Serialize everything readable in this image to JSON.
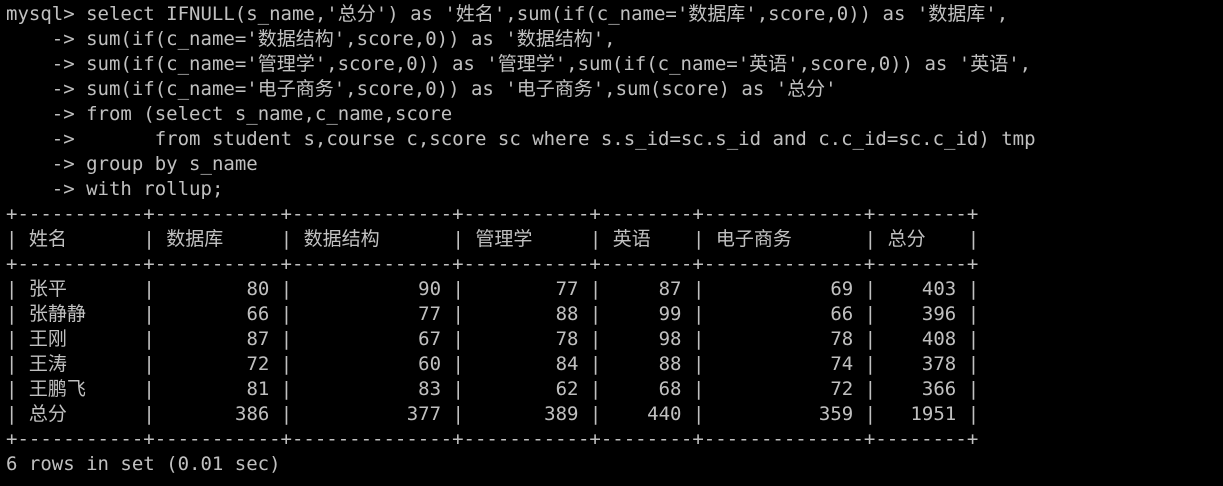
{
  "terminal": {
    "prompt": "mysql>",
    "continuation": "->",
    "query_lines": [
      "select IFNULL(s_name,'总分') as '姓名',sum(if(c_name='数据库',score,0)) as '数据库',",
      "sum(if(c_name='数据结构',score,0)) as '数据结构',",
      "sum(if(c_name='管理学',score,0)) as '管理学',sum(if(c_name='英语',score,0)) as '英语',",
      "sum(if(c_name='电子商务',score,0)) as '电子商务',sum(score) as '总分'",
      "from (select s_name,c_name,score",
      "      from student s,course c,score sc where s.s_id=sc.s_id and c.c_id=sc.c_id) tmp",
      "group by s_name",
      "with rollup;"
    ],
    "table": {
      "columns": [
        "姓名",
        "数据库",
        "数据结构",
        "管理学",
        "英语",
        "电子商务",
        "总分"
      ],
      "rows": [
        [
          "张平",
          "80",
          "90",
          "77",
          "87",
          "69",
          "403"
        ],
        [
          "张静静",
          "66",
          "77",
          "88",
          "99",
          "66",
          "396"
        ],
        [
          "王刚",
          "87",
          "67",
          "78",
          "98",
          "78",
          "408"
        ],
        [
          "王涛",
          "72",
          "60",
          "84",
          "88",
          "74",
          "378"
        ],
        [
          "王鹏飞",
          "81",
          "83",
          "62",
          "68",
          "72",
          "366"
        ],
        [
          "总分",
          "386",
          "377",
          "389",
          "440",
          "359",
          "1951"
        ]
      ]
    },
    "result_summary": "6 rows in set (0.01 sec)"
  },
  "colors": {
    "background": "#000000",
    "text": "#c0c0c0"
  }
}
